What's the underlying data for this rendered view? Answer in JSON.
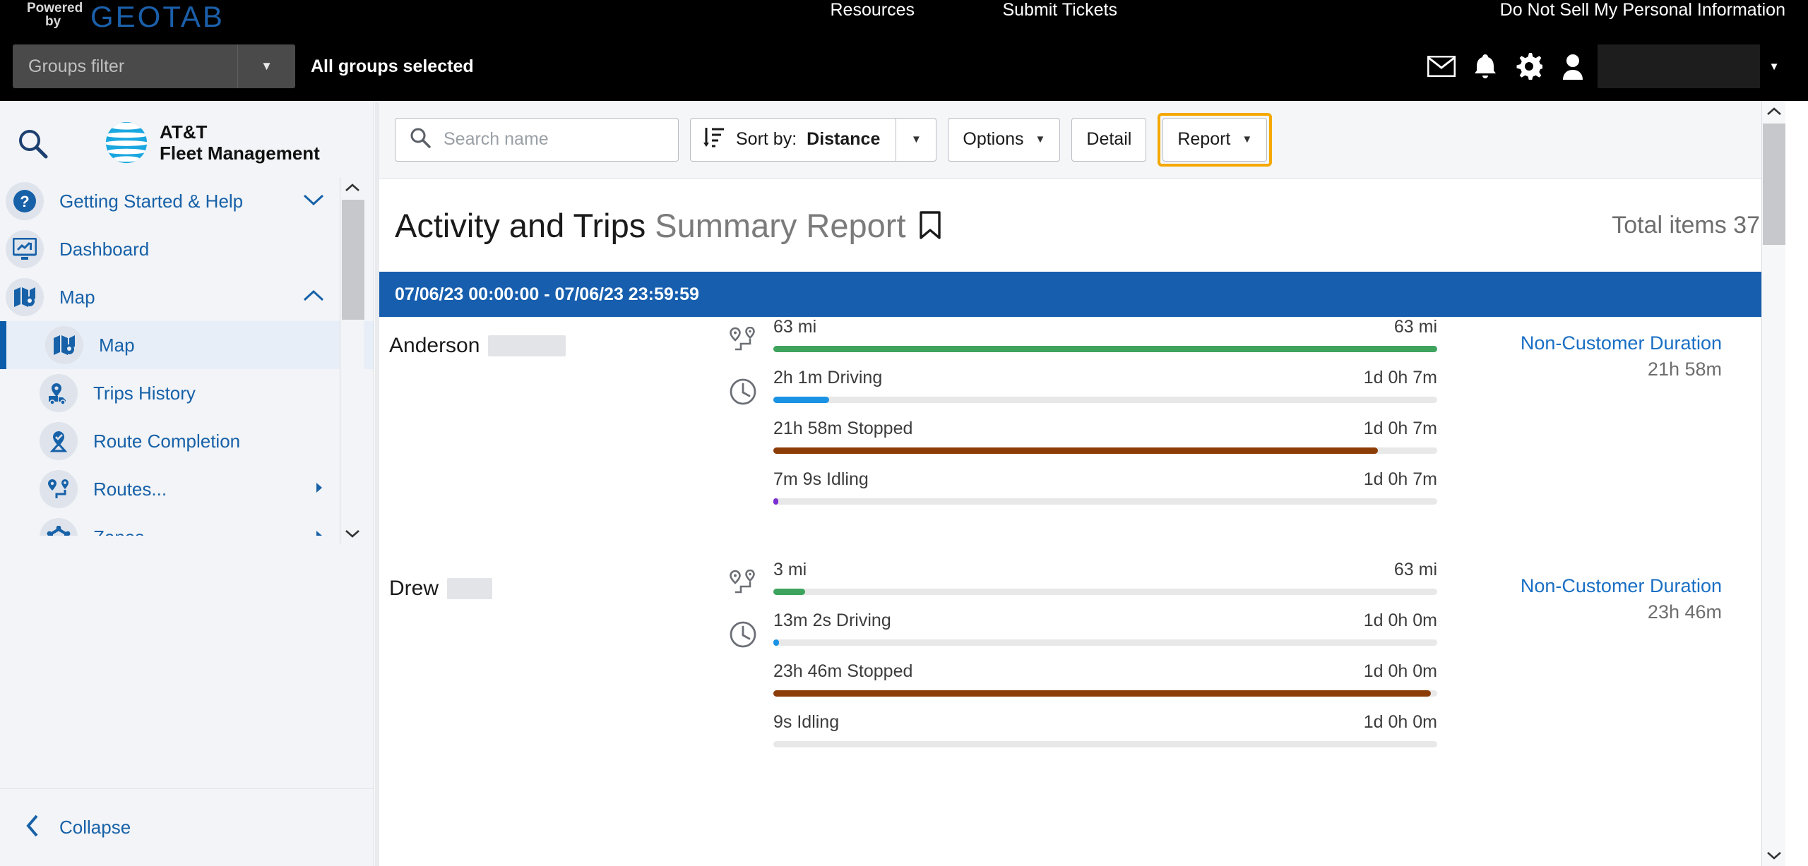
{
  "topbar": {
    "powered_line1": "Powered",
    "powered_line2": "by",
    "brand": "GEOTAB",
    "groups_filter_placeholder": "Groups filter",
    "groups_status": "All groups selected",
    "links": [
      {
        "label": "Resources"
      },
      {
        "label": "Submit Tickets"
      },
      {
        "label": "Do Not Sell My Personal Information"
      }
    ],
    "icons": [
      "mail-icon",
      "bell-icon",
      "gear-icon",
      "user-icon"
    ],
    "user_name": ""
  },
  "sidebar": {
    "search_icon": "search-icon",
    "logo": {
      "line1": "AT&T",
      "line2": "Fleet Management"
    },
    "items": [
      {
        "label": "Getting Started & Help",
        "icon": "help-circle-icon",
        "chevron": "chevron-down",
        "level": 0,
        "active": false
      },
      {
        "label": "Dashboard",
        "icon": "dashboard-icon",
        "chevron": "",
        "level": 0,
        "active": false
      },
      {
        "label": "Map",
        "icon": "map-icon",
        "chevron": "chevron-up",
        "level": 0,
        "active": false
      },
      {
        "label": "Map",
        "icon": "map-icon",
        "chevron": "",
        "level": 1,
        "active": true
      },
      {
        "label": "Trips History",
        "icon": "trips-history-icon",
        "chevron": "",
        "level": 1,
        "active": false
      },
      {
        "label": "Route Completion",
        "icon": "route-completion-icon",
        "chevron": "",
        "level": 1,
        "active": false
      },
      {
        "label": "Routes...",
        "icon": "routes-icon",
        "chevron": "chevron-right",
        "level": 1,
        "active": false
      },
      {
        "label": "Zones...",
        "icon": "zones-icon",
        "chevron": "chevron-right",
        "level": 1,
        "active": false
      }
    ],
    "collapse_label": "Collapse"
  },
  "toolbar": {
    "search_placeholder": "Search name",
    "sort_icon": "sort-descending-icon",
    "sort_label": "Sort by:",
    "sort_value": "Distance",
    "options_label": "Options",
    "detail_label": "Detail",
    "report_label": "Report",
    "highlight_color": "#f5a800"
  },
  "report": {
    "title_main": "Activity and Trips",
    "title_sub": "Summary Report",
    "bookmark_icon": "bookmark-icon",
    "total_items_label": "Total items 37",
    "date_range": "07/06/23 00:00:00 - 07/06/23 23:59:59",
    "date_bar_color": "#175fae"
  },
  "colors": {
    "distance": "#3da35d",
    "driving": "#1a93e5",
    "stopped": "#8c3c06",
    "idling": "#7b2fd1",
    "track": "#e8e8e8"
  },
  "chart_data": {
    "type": "bar",
    "title": "Activity and Trips Summary Report",
    "subtitle": "07/06/23 00:00:00 - 07/06/23 23:59:59",
    "xlabel": "",
    "ylabel": "",
    "grid": false,
    "legend": "none",
    "rows": [
      {
        "name": "Anderson",
        "name_redacted": true,
        "redact_width": 110,
        "right_title": "Non-Customer Duration",
        "right_value": "21h 58m",
        "metrics": [
          {
            "key": "distance",
            "icon": "route-pin-icon",
            "label": "63 mi",
            "max": "63 mi",
            "value": 63,
            "max_value": 63,
            "pct": 100,
            "color": "#3da35d"
          },
          {
            "key": "driving",
            "icon": "clock-icon",
            "label": "2h 1m Driving",
            "max": "1d 0h 7m",
            "value": 121,
            "max_value": 1447,
            "pct": 8.4,
            "color": "#1a93e5"
          },
          {
            "key": "stopped",
            "icon": "",
            "label": "21h 58m Stopped",
            "max": "1d 0h 7m",
            "value": 1318,
            "max_value": 1447,
            "pct": 91.1,
            "color": "#8c3c06"
          },
          {
            "key": "idling",
            "icon": "",
            "label": "7m 9s Idling",
            "max": "1d 0h 7m",
            "value": 7.15,
            "max_value": 1447,
            "pct": 0.5,
            "color": "#7b2fd1"
          }
        ]
      },
      {
        "name": "Drew",
        "name_redacted": true,
        "redact_width": 64,
        "right_title": "Non-Customer Duration",
        "right_value": "23h 46m",
        "metrics": [
          {
            "key": "distance",
            "icon": "route-pin-icon",
            "label": "3 mi",
            "max": "63 mi",
            "value": 3,
            "max_value": 63,
            "pct": 4.8,
            "color": "#3da35d"
          },
          {
            "key": "driving",
            "icon": "clock-icon",
            "label": "13m 2s Driving",
            "max": "1d 0h 0m",
            "value": 13,
            "max_value": 1440,
            "pct": 0.9,
            "color": "#1a93e5"
          },
          {
            "key": "stopped",
            "icon": "",
            "label": "23h 46m Stopped",
            "max": "1d 0h 0m",
            "value": 1426,
            "max_value": 1440,
            "pct": 99,
            "color": "#8c3c06"
          },
          {
            "key": "idling",
            "icon": "",
            "label": "9s Idling",
            "max": "1d 0h 0m",
            "value": 0.15,
            "max_value": 1440,
            "pct": 0,
            "color": "#7b2fd1"
          }
        ]
      }
    ]
  }
}
